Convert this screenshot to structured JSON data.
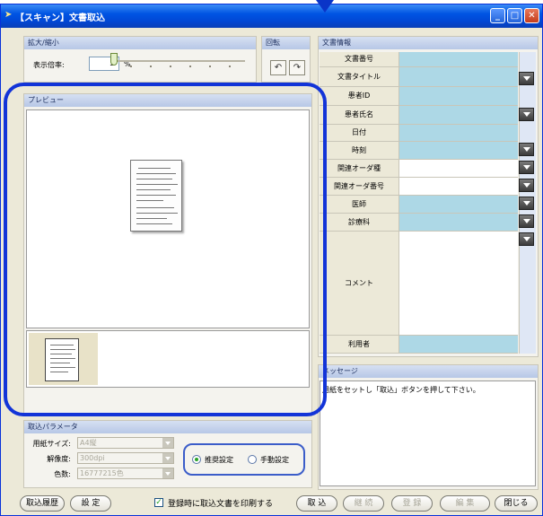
{
  "window": {
    "title": "【スキャン】文書取込",
    "controls": [
      "minimize",
      "maximize",
      "close"
    ]
  },
  "zoom": {
    "header": "拡大/縮小",
    "label": "表示倍率:",
    "value": "5",
    "unit": "%"
  },
  "rotation": {
    "header": "回転"
  },
  "preview": {
    "header": "プレビュー"
  },
  "params": {
    "header": "取込パラメータ",
    "paper_label": "用紙サイズ:",
    "paper_value": "A4縦",
    "resolution_label": "解像度:",
    "resolution_value": "300dpi",
    "color_label": "色数:",
    "color_value": "16777215色",
    "radio_recommended": "推奨設定",
    "radio_manual": "手動設定"
  },
  "doc_info": {
    "header": "文書情報",
    "rows": [
      {
        "label": "文書番号"
      },
      {
        "label": "文書タイトル"
      },
      {
        "label": "患者ID"
      },
      {
        "label": "患者氏名"
      },
      {
        "label": "日付"
      },
      {
        "label": "時刻"
      },
      {
        "label": "関連オーダ種"
      },
      {
        "label": "関連オーダ番号"
      },
      {
        "label": "医師"
      },
      {
        "label": "診療科"
      },
      {
        "label": "コメント"
      },
      {
        "label": "利用者"
      }
    ]
  },
  "message": {
    "header": "メッセージ",
    "text": "用紙をセットし「取込」ボタンを押して下さい。"
  },
  "footer": {
    "history_button": "取込履歴",
    "settings_button": "設 定",
    "print_checkbox_label": "登録時に取込文書を印刷する",
    "capture_button": "取 込",
    "continue_button": "継 続",
    "register_button": "登 録",
    "edit_button": "編 集",
    "close_button": "閉じる"
  },
  "colors": {
    "titlebar": "#0054e3",
    "highlight_outline": "#1234d8",
    "field_blue": "#add8e6"
  }
}
